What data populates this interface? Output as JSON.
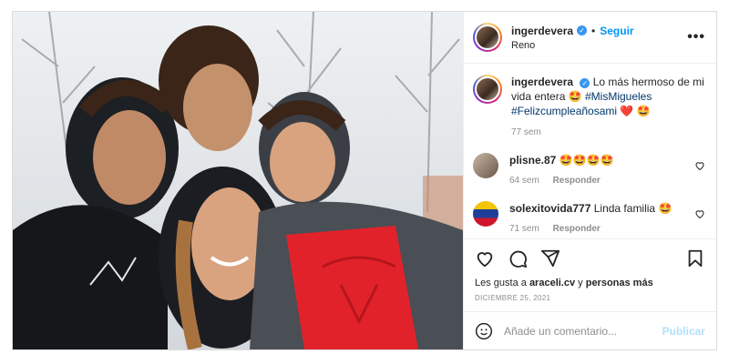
{
  "post": {
    "username": "ingerdevera",
    "follow_label": "Seguir",
    "location": "Reno",
    "more_label": "•••",
    "caption": {
      "text": "Lo más hermoso de mi vida entera 🤩",
      "hashtag1": "#MisMigueles",
      "hashtag2": "#Felizcumpleañosami",
      "emojis": "❤️ 🤩",
      "time": "77 sem"
    },
    "comments": [
      {
        "username": "plisne.87",
        "text": "🤩🤩🤩🤩",
        "time": "64 sem",
        "reply_label": "Responder"
      },
      {
        "username": "solexitovida777",
        "text": "Linda familia 🤩",
        "time": "71 sem",
        "reply_label": "Responder"
      }
    ],
    "likes_prefix": "Les gusta a ",
    "likes_user": "araceli.cv",
    "likes_mid": " y ",
    "likes_suffix": "personas más",
    "date": "DICIEMBRE 25, 2021",
    "add_comment_placeholder": "Añade un comentario...",
    "publish_label": "Publicar"
  },
  "colors": {
    "accent": "#0095f6",
    "verified": "#3897f0",
    "muted": "#8e8e8e"
  }
}
